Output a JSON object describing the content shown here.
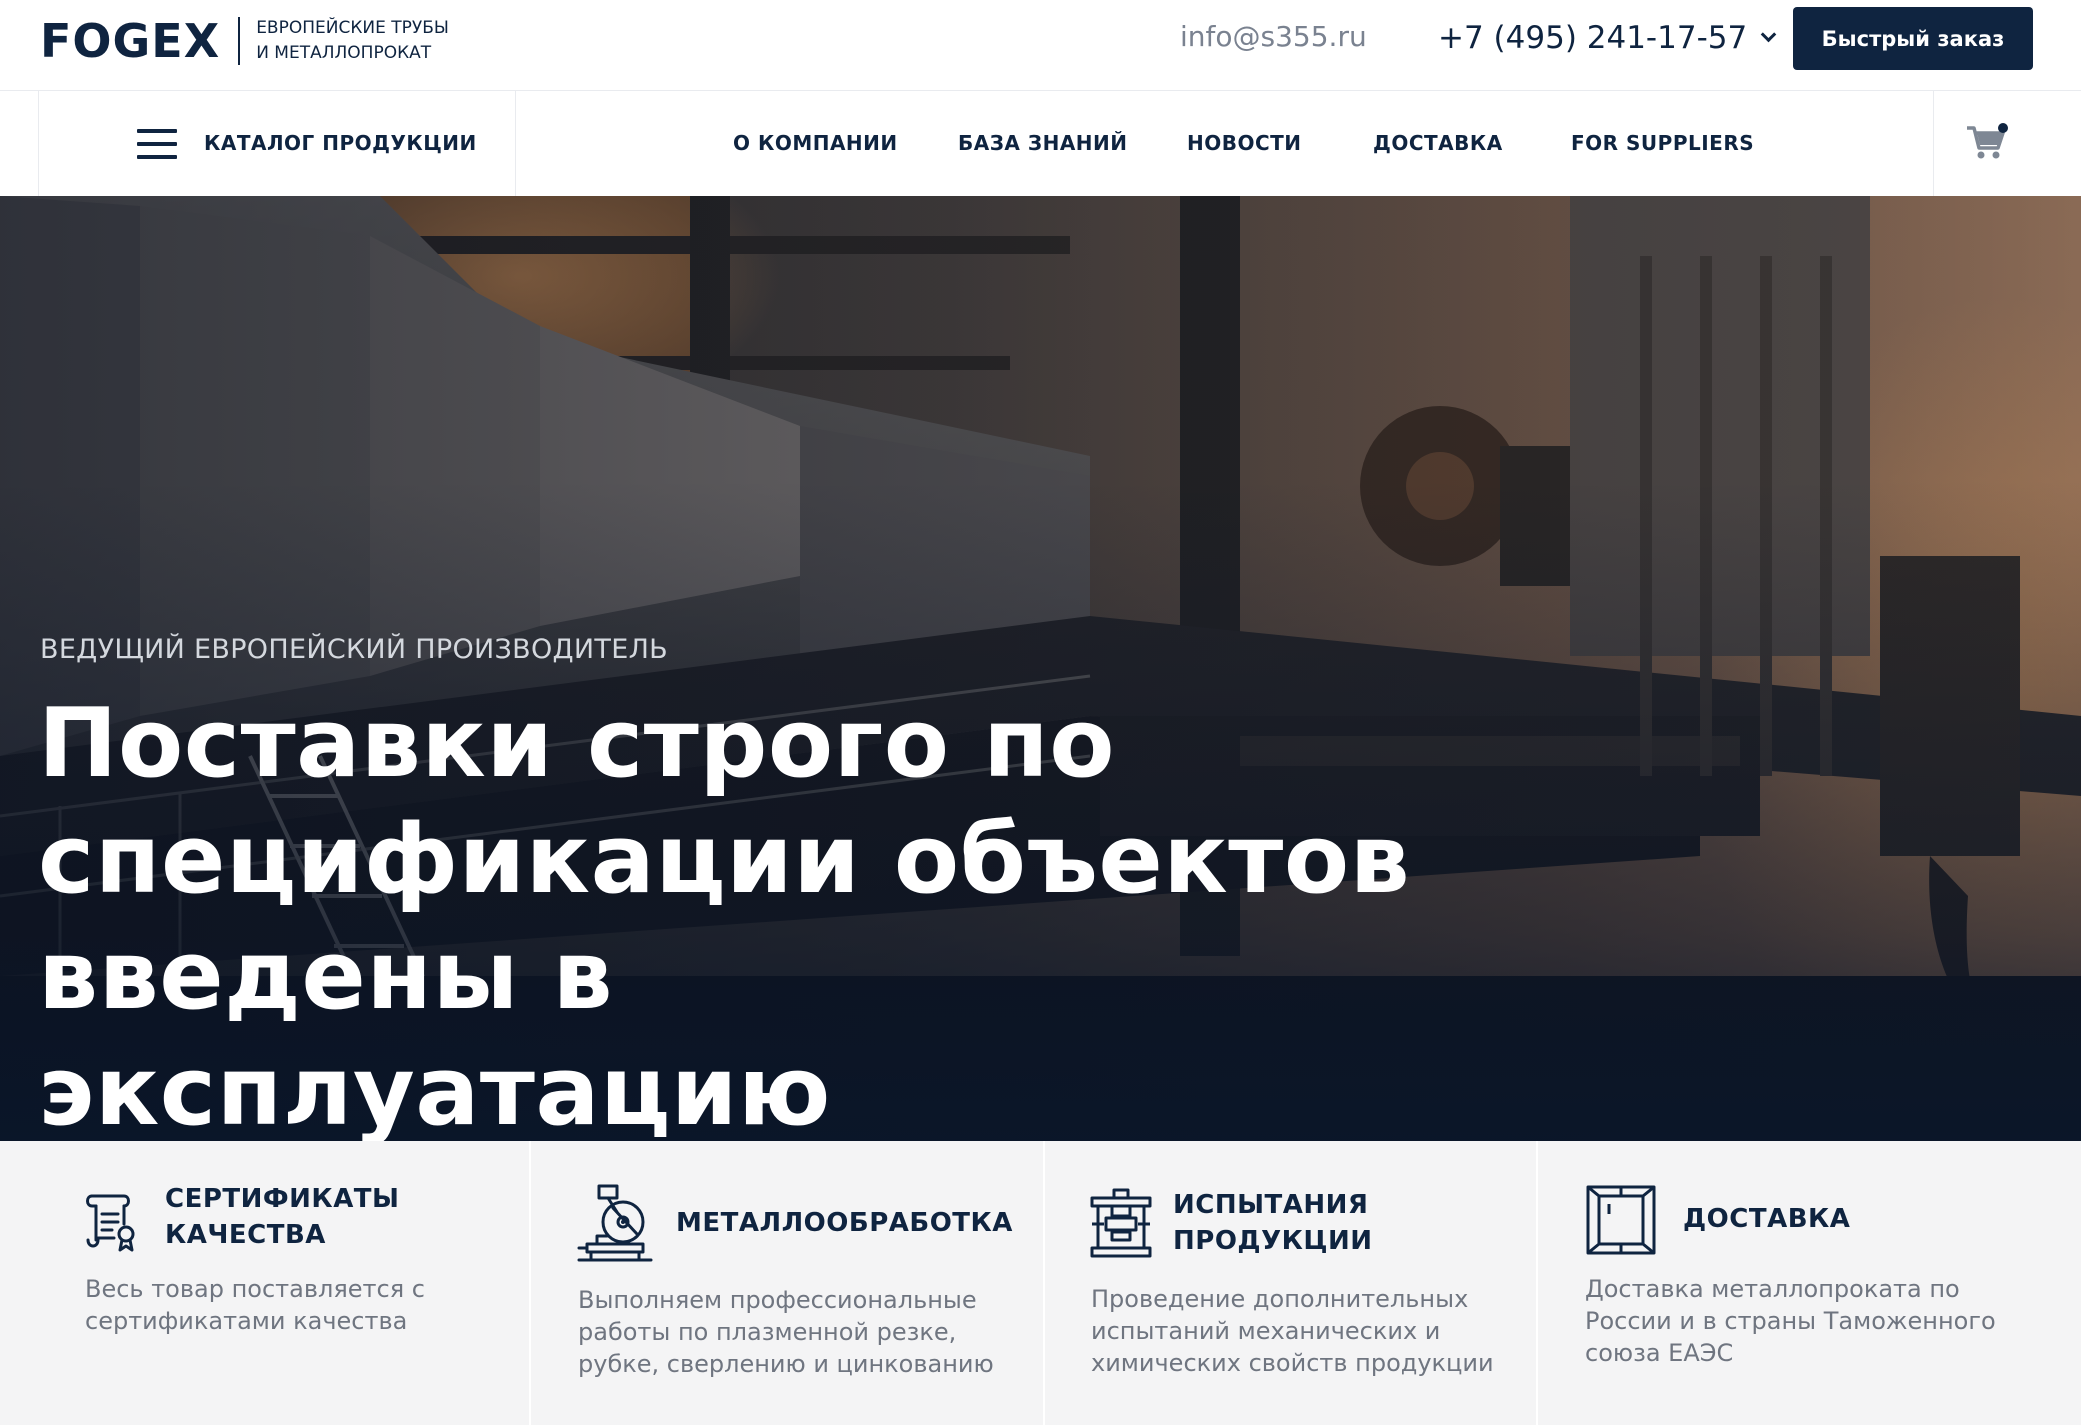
{
  "brand": {
    "logo": "FOGEX",
    "tagline_line1": "ЕВРОПЕЙСКИЕ ТРУБЫ",
    "tagline_line2": "И МЕТАЛЛОПРОКАТ"
  },
  "contacts": {
    "email": "info@s355.ru",
    "phone": "+7 (495) 241-17-57"
  },
  "header": {
    "order_button": "Быстрый заказ"
  },
  "nav": {
    "catalog": "КАТАЛОГ ПРОДУКЦИИ",
    "items": [
      {
        "label": "О КОМПАНИИ"
      },
      {
        "label": "БАЗА ЗНАНИЙ"
      },
      {
        "label": "НОВОСТИ"
      },
      {
        "label": "ДОСТАВКА"
      },
      {
        "label": "FOR SUPPLIERS"
      }
    ],
    "cart_icon": "cart-icon"
  },
  "hero": {
    "kicker": "ВЕДУЩИЙ ЕВРОПЕЙСКИЙ ПРОИЗВОДИТЕЛЬ",
    "title_line1": "Поставки строго по",
    "title_line2": "спецификации объектов",
    "title_line3": "введены в эксплуатацию"
  },
  "features": [
    {
      "icon": "scroll-certificate-icon",
      "title_line1": "СЕРТИФИКАТЫ",
      "title_line2": "КАЧЕСТВА",
      "text_line1": "Весь товар поставляется с",
      "text_line2": "сертификатами качества",
      "text_line3": ""
    },
    {
      "icon": "cutting-saw-icon",
      "title_line1": "МЕТАЛЛООБРАБОТКА",
      "title_line2": "",
      "text_line1": "Выполняем профессиональные",
      "text_line2": "работы по плазменной резке,",
      "text_line3": "рубке, сверлению и цинкованию"
    },
    {
      "icon": "testing-press-icon",
      "title_line1": "ИСПЫТАНИЯ",
      "title_line2": "ПРОДУКЦИИ",
      "text_line1": "Проведение дополнительных",
      "text_line2": "испытаний механических и",
      "text_line3": "химических свойств продукции"
    },
    {
      "icon": "box-delivery-icon",
      "title_line1": "ДОСТАВКА",
      "title_line2": "",
      "text_line1": "Доставка металлопроката по",
      "text_line2": "России и в страны Таможенного",
      "text_line3": "союза ЕАЭС"
    }
  ],
  "colors": {
    "navy": "#0f2440",
    "muted_text": "#6f7580",
    "feature_bg": "#f4f4f5"
  }
}
